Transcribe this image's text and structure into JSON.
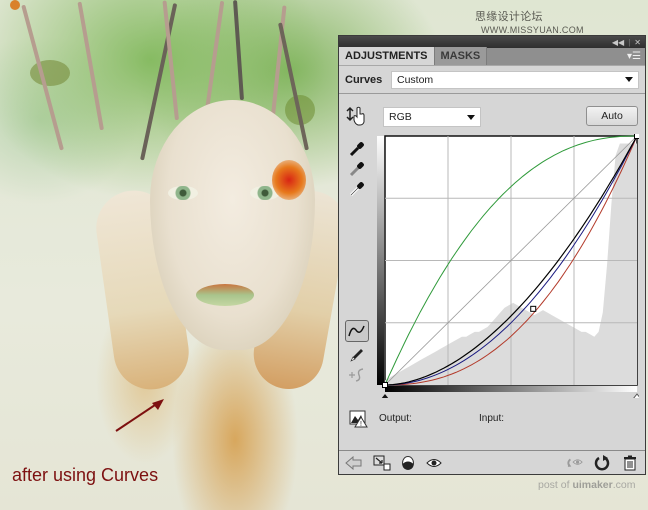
{
  "watermarks": {
    "top_cn": "思缘设计论坛",
    "top_url": "WWW.MISSYUAN.COM",
    "bottom_prefix": "post of ",
    "bottom_brand": "uimaker",
    "bottom_suffix": ".com"
  },
  "annotation": {
    "text": "after using Curves",
    "color": "#7d1010"
  },
  "panel": {
    "titlebar": {
      "collapse_icon": "double-chevron-left-icon",
      "close_icon": "close-icon"
    },
    "tabs": [
      {
        "label": "ADJUSTMENTS",
        "active": true
      },
      {
        "label": "MASKS",
        "active": false
      }
    ],
    "menu_icon": "panel-menu-icon",
    "preset": {
      "label": "Curves",
      "value": "Custom"
    },
    "channel": {
      "value": "RGB"
    },
    "auto_label": "Auto",
    "tools": [
      {
        "name": "on-image-adjust-tool",
        "icon": "hand-arrows-icon"
      },
      {
        "name": "black-point-eyedropper",
        "icon": "eyedropper-black-icon"
      },
      {
        "name": "gray-point-eyedropper",
        "icon": "eyedropper-gray-icon"
      },
      {
        "name": "white-point-eyedropper",
        "icon": "eyedropper-white-icon"
      },
      {
        "name": "edit-points-mode",
        "icon": "curve-icon",
        "active": true
      },
      {
        "name": "draw-mode",
        "icon": "pencil-icon"
      },
      {
        "name": "smooth-curve",
        "icon": "smooth-icon"
      }
    ],
    "output_label": "Output:",
    "input_label": "Input:",
    "footer_icons": [
      "back-arrow-icon",
      "clip-to-layer-icon",
      "visibility-toggle-icon",
      "eye-icon",
      "view-previous-icon",
      "reset-icon",
      "trash-icon"
    ],
    "curves": {
      "grid_divisions": 4,
      "range": [
        0,
        255
      ],
      "colors": {
        "composite": "#000000",
        "red": "#b33a2a",
        "green": "#2f9a3a",
        "blue": "#1a1a80",
        "baseline": "#9a9a9a"
      },
      "composite_point": {
        "input": 150,
        "output": 78
      }
    }
  }
}
